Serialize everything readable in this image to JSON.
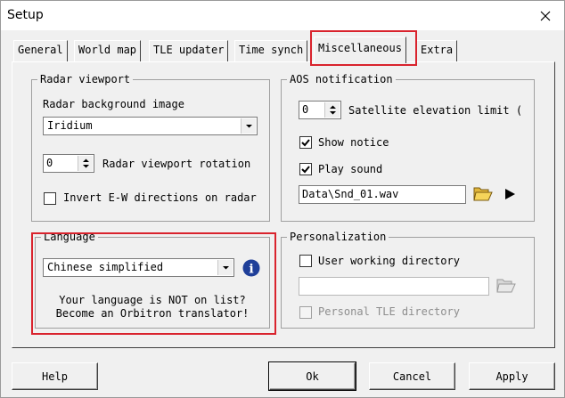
{
  "window": {
    "title": "Setup"
  },
  "tabs": [
    {
      "label": "General"
    },
    {
      "label": "World map"
    },
    {
      "label": "TLE updater"
    },
    {
      "label": "Time synch"
    },
    {
      "label": "Miscellaneous"
    },
    {
      "label": "Extra"
    }
  ],
  "radar": {
    "legend": "Radar viewport",
    "background_label": "Radar background image",
    "background_value": "Iridium",
    "rotation_value": "0",
    "rotation_label": "Radar viewport rotation",
    "invert_label": "Invert E-W directions on radar"
  },
  "aos": {
    "legend": "AOS notification",
    "elevation_value": "0",
    "elevation_label": "Satellite elevation limit (",
    "show_notice_label": "Show notice",
    "play_sound_label": "Play sound",
    "sound_file": "Data\\Snd_01.wav"
  },
  "language": {
    "legend": "Language",
    "value": "Chinese simplified",
    "note_line1": "Your language is NOT on list?",
    "note_line2": "Become an Orbitron translator!"
  },
  "personalization": {
    "legend": "Personalization",
    "user_dir_label": "User working directory",
    "user_dir_value": "",
    "tle_dir_label": "Personal TLE directory"
  },
  "buttons": {
    "help": "Help",
    "ok": "Ok",
    "cancel": "Cancel",
    "apply": "Apply"
  },
  "colors": {
    "highlight": "#d9232d",
    "info_icon": "#1f3f99"
  }
}
